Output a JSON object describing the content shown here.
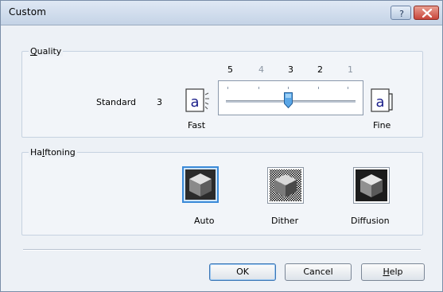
{
  "window": {
    "title": "Custom"
  },
  "quality": {
    "group_label_prefix": "",
    "group_label_mnemonic": "Q",
    "group_label_rest": "uality",
    "current_mode": "Standard",
    "current_value": "3",
    "scale_labels": [
      "5",
      "4",
      "3",
      "2",
      "1"
    ],
    "selected_value": 3,
    "fast_label": "Fast",
    "fine_label": "Fine",
    "doc_icon_glyph": "a"
  },
  "halftoning": {
    "group_label_prefix": "Ha",
    "group_label_mnemonic": "l",
    "group_label_rest": "ftoning",
    "options": [
      {
        "label": "Auto",
        "selected": true,
        "icon": "cube-auto-icon"
      },
      {
        "label": "Dither",
        "selected": false,
        "icon": "cube-dither-icon"
      },
      {
        "label": "Diffusion",
        "selected": false,
        "icon": "cube-diffusion-icon"
      }
    ]
  },
  "buttons": {
    "ok": "OK",
    "cancel": "Cancel",
    "help_mnemonic": "H",
    "help_rest": "elp"
  },
  "titlebar_buttons": {
    "help_glyph": "?"
  },
  "colors": {
    "accent": "#3a8ad8",
    "thumb": "#5aa6e6"
  }
}
